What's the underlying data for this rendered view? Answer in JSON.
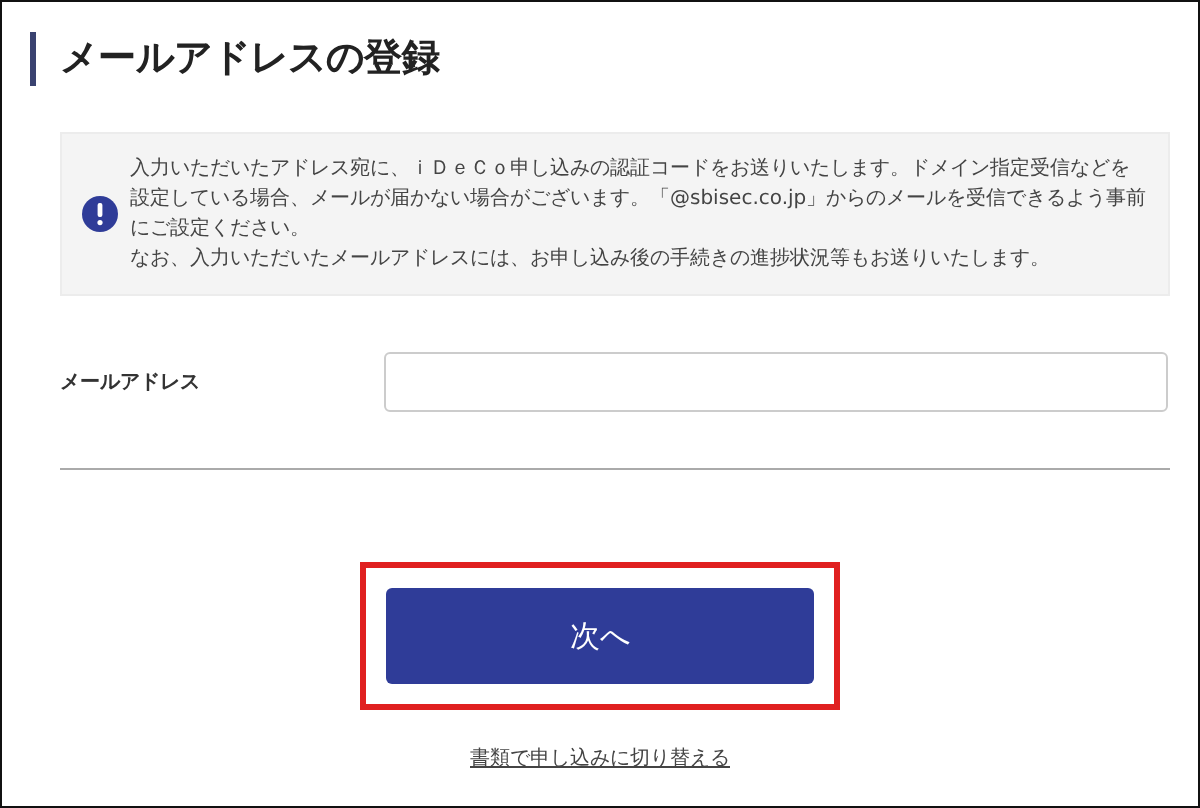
{
  "page": {
    "title": "メールアドレスの登録"
  },
  "notice": {
    "paragraphs": [
      "入力いただいたアドレス宛に、ｉＤｅＣｏ申し込みの認証コードをお送りいたします。ドメイン指定受信などを設定している場合、メールが届かない場合がございます。「@sbisec.co.jp」からのメールを受信できるよう事前にご設定ください。",
      "なお、入力いただいたメールアドレスには、お申し込み後の手続きの進捗状況等もお送りいたします。"
    ]
  },
  "form": {
    "fields": [
      {
        "label": "メールアドレス"
      }
    ]
  },
  "next_button": {
    "label": "次へ",
    "highlighted": true
  },
  "link": {
    "label": "書類で申し込みに切り替える"
  }
}
